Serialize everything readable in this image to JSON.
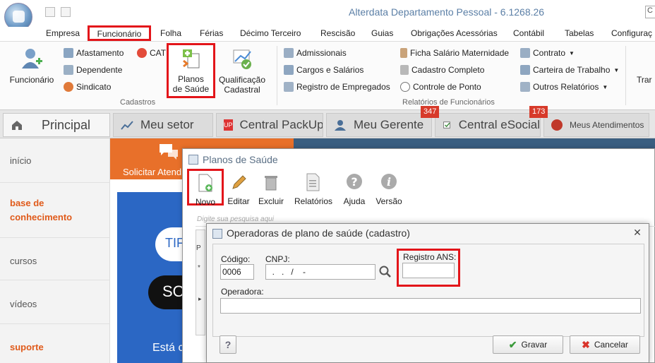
{
  "window": {
    "title": "Alterdata Departamento Pessoal - 6.1268.26"
  },
  "menu": {
    "tabs": [
      "Empresa",
      "Funcionário",
      "Folha",
      "Férias",
      "Décimo Terceiro",
      "Rescisão",
      "Guias",
      "Obrigações Acessórias",
      "Contábil",
      "Tabelas",
      "Configuraç"
    ]
  },
  "ribbon": {
    "cadastros": {
      "group_label": "Cadastros",
      "funcionario": "Funcionário",
      "afastamento": "Afastamento",
      "dependente": "Dependente",
      "sindicato": "Sindicato",
      "cat": "CAT",
      "planos_line1": "Planos",
      "planos_line2": "de Saúde",
      "qualif_line1": "Qualificação",
      "qualif_line2": "Cadastral"
    },
    "relatorios": {
      "group_label": "Relatórios de Funcionários",
      "admissionais": "Admissionais",
      "cargos": "Cargos e Salários",
      "registro": "Registro de Empregados",
      "ficha": "Ficha Salário Maternidade",
      "completo": "Cadastro Completo",
      "ponto": "Controle de Ponto",
      "contrato": "Contrato",
      "carteira": "Carteira de Trabalho",
      "outros": "Outros Relatórios"
    },
    "partial": "Trar"
  },
  "workspace_tabs": {
    "principal": "Principal",
    "meu_setor": "Meu setor",
    "packup": "Central PackUp",
    "gerente": "Meu Gerente",
    "esocial": "Central eSocial",
    "atendimentos": "Meus Atendimentos",
    "badge_gerente": "347",
    "badge_esocial": "173",
    "up_label": "UP"
  },
  "leftnav": {
    "inicio": "início",
    "base_line1": "base de",
    "base_line2": "conhecimento",
    "cursos": "cursos",
    "videos": "vídeos",
    "suporte": "suporte"
  },
  "banner": {
    "text": "Solicitar Atend"
  },
  "ad": {
    "text1": "TIF",
    "text2": "SO",
    "text3": "Está c"
  },
  "planos": {
    "title": "Planos de Saúde",
    "novo": "Novo",
    "editar": "Editar",
    "excluir": "Excluir",
    "relatorios": "Relatórios",
    "ajuda": "Ajuda",
    "versao": "Versão",
    "search_placeholder": "Digite sua pesquisa aqui",
    "grid_marker": "*",
    "grid_arrow": "▸",
    "grid_p": "P"
  },
  "dialog": {
    "title": "Operadoras de plano de saúde (cadastro)",
    "codigo_label": "Código:",
    "codigo_value": "0006",
    "cnpj_label": "CNPJ:",
    "cnpj_value": "  .   .   /    -",
    "registro_label": "Registro ANS:",
    "operadora_label": "Operadora:",
    "help": "?",
    "gravar": "Gravar",
    "cancelar": "Cancelar",
    "close": "✕"
  }
}
